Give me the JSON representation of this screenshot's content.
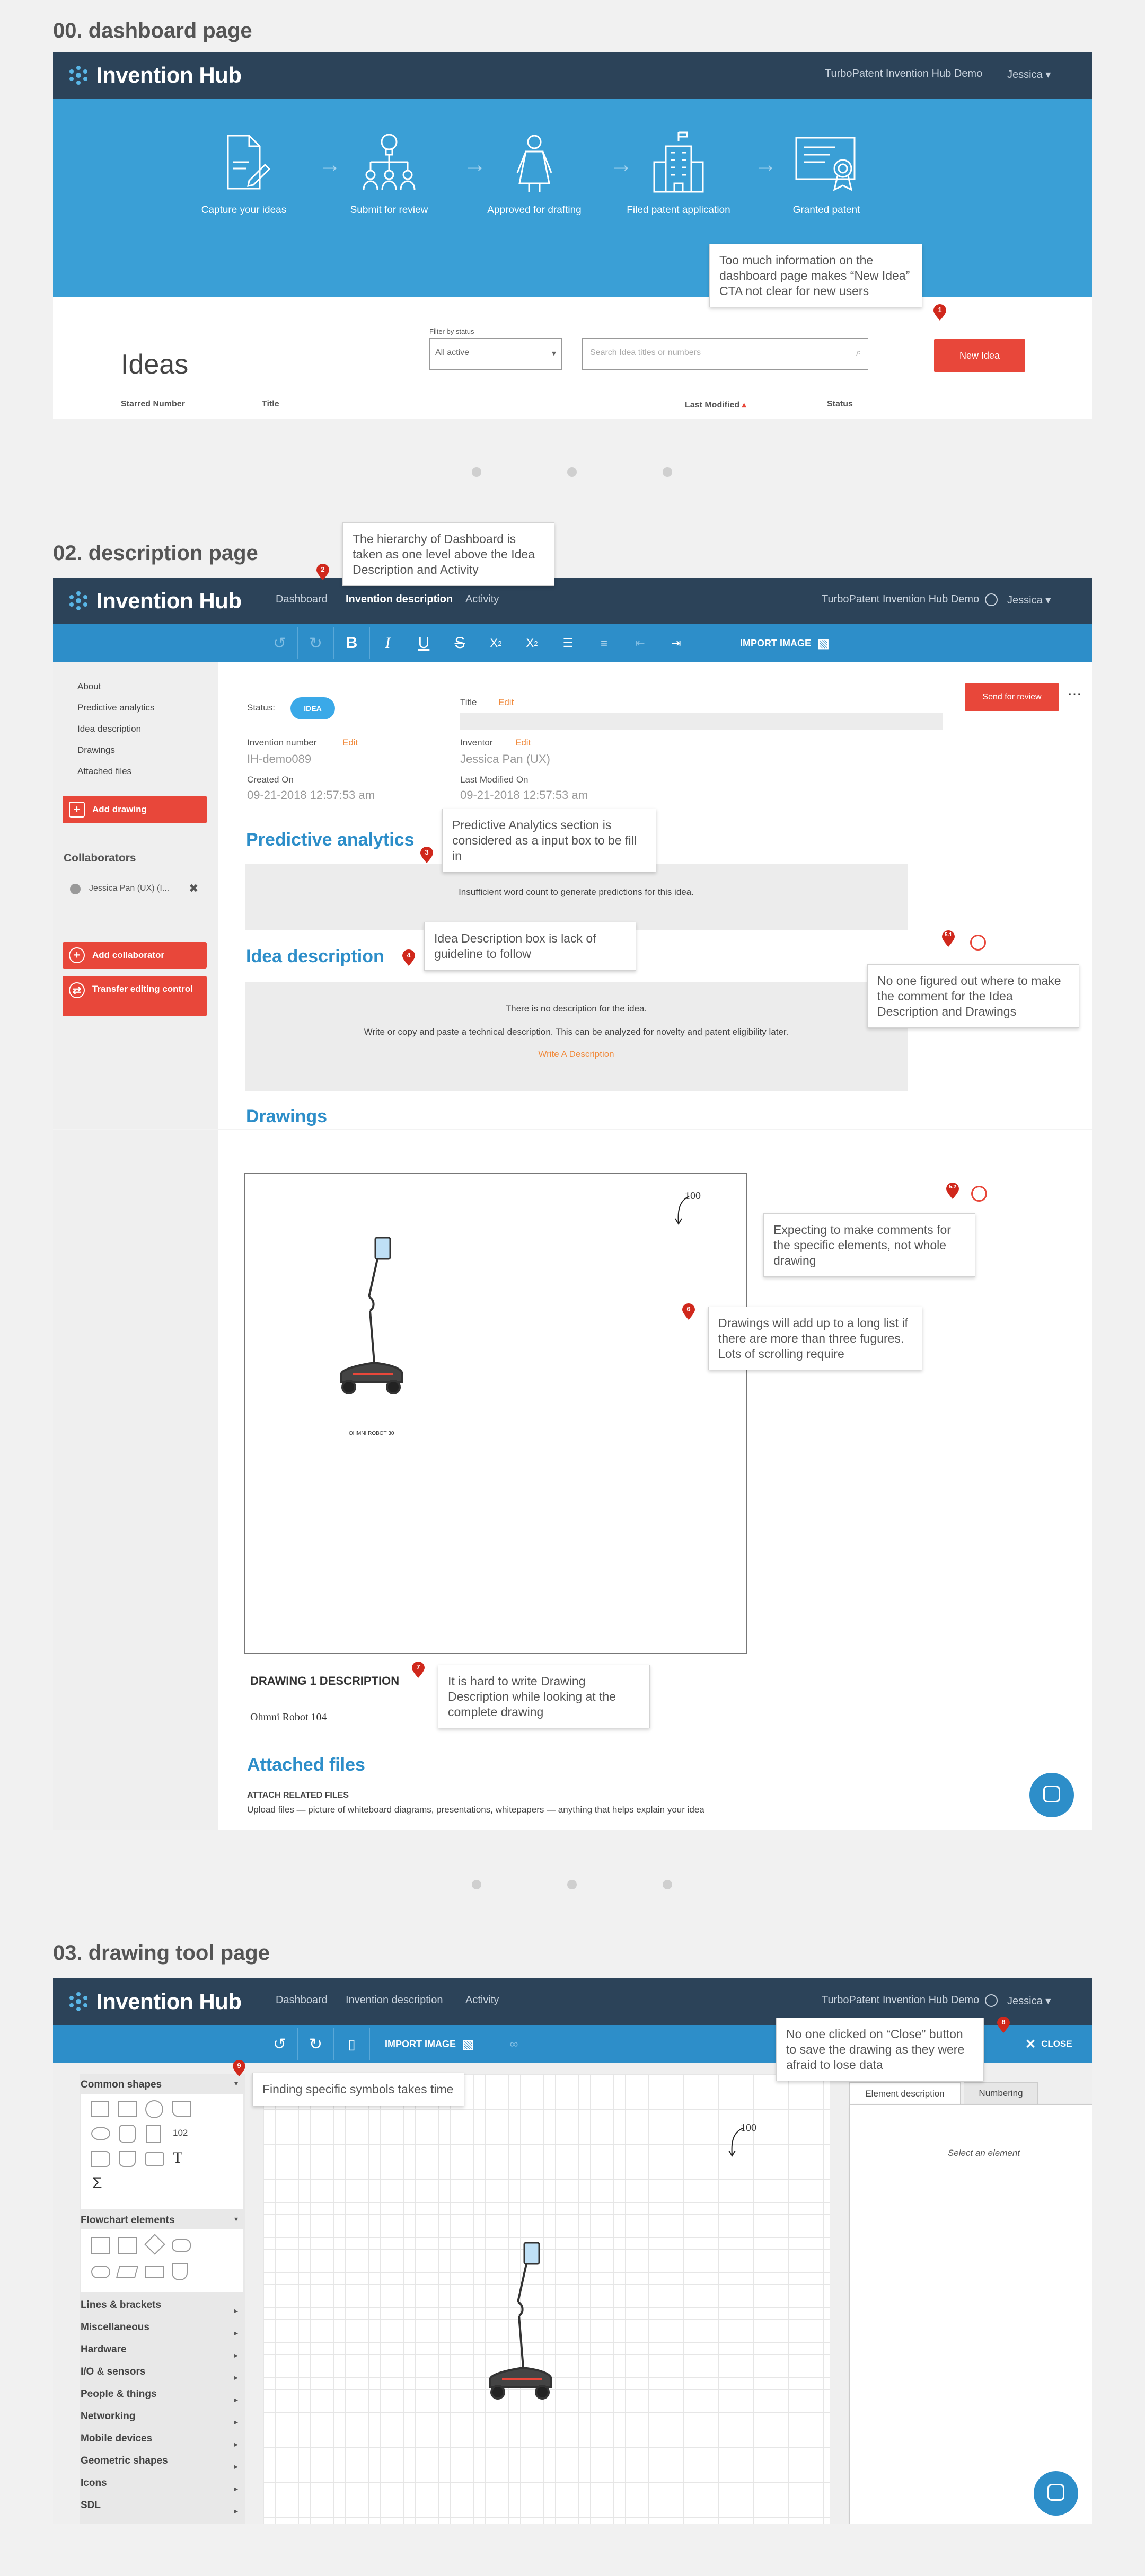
{
  "sections": {
    "dashboard": "00. dashboard page",
    "description": "02. description page",
    "drawing": "03. drawing tool page"
  },
  "brand": {
    "logo": "Invention Hub",
    "demo": "TurboPatent Invention Hub Demo",
    "user": "Jessica",
    "accent": "#2d8ec9",
    "nav_bg": "#2c4359",
    "red": "#e8473a"
  },
  "nav": {
    "dashboard": "Dashboard",
    "description": "Invention description",
    "activity": "Activity"
  },
  "dashboard": {
    "steps": [
      "Capture your ideas",
      "Submit for review",
      "Approved for drafting",
      "Filed patent application",
      "Granted patent"
    ],
    "title": "Ideas",
    "filter_label": "Filter by status",
    "filter_value": "All active",
    "search_placeholder": "Search Idea titles or numbers",
    "new_button": "New Idea",
    "columns": [
      "Starred Number",
      "Title",
      "Last Modified",
      "Status"
    ]
  },
  "description": {
    "toolbar": {
      "import": "IMPORT IMAGE",
      "sub": "X2",
      "sup": "X2"
    },
    "side_links": [
      "About",
      "Predictive analytics",
      "Idea description",
      "Drawings",
      "Attached files"
    ],
    "add_drawing": "Add drawing",
    "collaborators": "Collaborators",
    "collaborator": "Jessica Pan (UX)   (I...",
    "add_collaborator": "Add collaborator",
    "transfer": "Transfer editing control",
    "send": "Send for review",
    "status_label": "Status:",
    "status_value": "IDEA",
    "title_label": "Title",
    "edit": "Edit",
    "inv_num_label": "Invention number",
    "inv_num": "IH-demo089",
    "inventor_label": "Inventor",
    "inventor": "Jessica Pan (UX)",
    "created_label": "Created On",
    "created": "09-21-2018 12:57:53 am",
    "modified_label": "Last Modified On",
    "modified": "09-21-2018 12:57:53 am",
    "pa_title": "Predictive analytics",
    "pa_text": "Insufficient word count to generate predictions for this idea.",
    "id_title": "Idea description",
    "id_line1": "There is no description for the idea.",
    "id_line2": "Write or copy and paste a technical description. This can be analyzed for novelty and patent eligibility later.",
    "id_link": "Write A Description",
    "drawings_title": "Drawings",
    "ref_num": "100",
    "robot_caption": "OHMNI ROBOT 30",
    "d1_title": "DRAWING 1 DESCRIPTION",
    "d1_text": "Ohmni Robot 104",
    "af_title": "Attached files",
    "af_sub": "ATTACH RELATED FILES",
    "af_text": "Upload files — picture of whiteboard diagrams, presentations, whitepapers — anything that helps explain your idea"
  },
  "drawing_tool": {
    "import": "IMPORT IMAGE",
    "close": "CLOSE",
    "common": "Common shapes",
    "shape_num": "102",
    "text_tool": "T",
    "sigma": "Σ",
    "flowchart": "Flowchart elements",
    "categories": [
      "Lines & brackets",
      "Miscellaneous",
      "Hardware",
      "I/O & sensors",
      "People & things",
      "Networking",
      "Mobile devices",
      "Geometric shapes",
      "Icons",
      "SDL"
    ],
    "tab1": "Element description",
    "tab2": "Numbering",
    "select": "Select an element",
    "ref_num": "100"
  },
  "notes": {
    "n1": "Too much information on the dashboard page makes “New Idea” CTA not clear for new users",
    "n2": "The hierarchy of Dashboard is taken as one level above the Idea Description and Activity",
    "n3": "Predictive Analytics section is considered as a input box to be fill in",
    "n4": "Idea Description box is lack of guideline to follow",
    "n51": "No one figured out where to make the comment for the Idea Description and Drawings",
    "n52": "Expecting to make comments for the specific elements, not whole drawing",
    "n6": "Drawings will add up to a long list if there are more than three fugures. Lots of scrolling require",
    "n7": "It is hard to write Drawing Description while looking at the complete drawing",
    "n8": "No one clicked on “Close” button to save the drawing as they were afraid to lose data",
    "n9": "Finding specific symbols takes time"
  },
  "pins": {
    "p1": "1",
    "p2": "2",
    "p3": "3",
    "p4": "4",
    "p51": "5.1",
    "p52": "5.2",
    "p6": "6",
    "p7": "7",
    "p8": "8",
    "p9": "9"
  }
}
